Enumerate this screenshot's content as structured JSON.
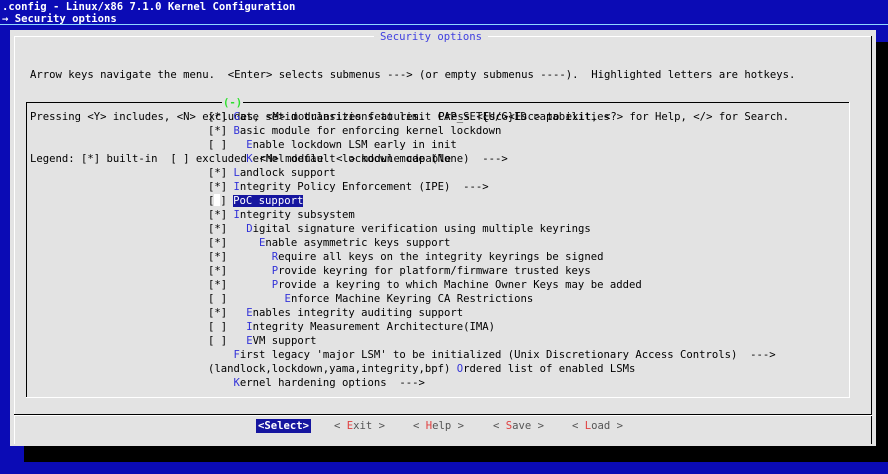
{
  "header": {
    "line1": ".config - Linux/x86 7.1.0 Kernel Configuration",
    "line2": "→ Security options"
  },
  "dialog": {
    "title": "Security options",
    "help": [
      "Arrow keys navigate the menu.  <Enter> selects submenus ---> (or empty submenus ----).  Highlighted letters are hotkeys.",
      "Pressing <Y> includes, <N> excludes, <M> modularizes features.  Press <Esc><Esc> to exit, <?> for Help, </> for Search.",
      "Legend: [*] built-in  [ ] excluded  <M> module  < > module capable"
    ],
    "scroll_indicator": "(-)"
  },
  "menu": {
    "items": [
      {
        "prefix": "[*] ",
        "hot": "G",
        "text": "ate setid transitions to limit CAP_SET{U/G}ID capabilities"
      },
      {
        "prefix": "[*] ",
        "hot": "B",
        "text": "asic module for enforcing kernel lockdown"
      },
      {
        "prefix": "[ ]   ",
        "hot": "E",
        "text": "nable lockdown LSM early in init"
      },
      {
        "prefix": "      ",
        "hot": "K",
        "text": "ernel default lockdown mode (None)  --->"
      },
      {
        "prefix": "[*] ",
        "hot": "L",
        "text": "andlock support"
      },
      {
        "prefix": "[*] ",
        "hot": "I",
        "text": "ntegrity Policy Enforcement (IPE)  --->"
      },
      {
        "prefix": "[ ] ",
        "hot": "P",
        "text": "oC support",
        "selected": true
      },
      {
        "prefix": "[*] ",
        "hot": "I",
        "text": "ntegrity subsystem"
      },
      {
        "prefix": "[*]   ",
        "hot": "D",
        "text": "igital signature verification using multiple keyrings"
      },
      {
        "prefix": "[*]     ",
        "hot": "E",
        "text": "nable asymmetric keys support"
      },
      {
        "prefix": "[*]       ",
        "hot": "R",
        "text": "equire all keys on the integrity keyrings be signed"
      },
      {
        "prefix": "[*]       ",
        "hot": "P",
        "text": "rovide keyring for platform/firmware trusted keys"
      },
      {
        "prefix": "[*]       ",
        "hot": "P",
        "text": "rovide a keyring to which Machine Owner Keys may be added"
      },
      {
        "prefix": "[ ]         ",
        "hot": "E",
        "text": "nforce Machine Keyring CA Restrictions"
      },
      {
        "prefix": "[*]   ",
        "hot": "E",
        "text": "nables integrity auditing support"
      },
      {
        "prefix": "[ ]   ",
        "hot": "I",
        "text": "ntegrity Measurement Architecture(IMA)"
      },
      {
        "prefix": "[ ]   ",
        "hot": "E",
        "text": "VM support"
      },
      {
        "prefix": "    ",
        "hot": "F",
        "text": "irst legacy 'major LSM' to be initialized (Unix Discretionary Access Controls)  --->"
      },
      {
        "prefix": "(landlock,lockdown,yama,integrity,bpf) ",
        "hot": "O",
        "text": "rdered list of enabled LSMs"
      },
      {
        "prefix": "    ",
        "hot": "K",
        "text": "ernel hardening options  --->"
      }
    ]
  },
  "buttons": {
    "select": "<Select>",
    "exit_open": "< ",
    "exit_key": "E",
    "exit_rest": "xit >",
    "help_open": "< ",
    "help_key": "H",
    "help_rest": "elp >",
    "save_open": "< ",
    "save_key": "S",
    "save_rest": "ave >",
    "load_open": "< ",
    "load_key": "L",
    "load_rest": "oad >"
  },
  "colors": {
    "background": "#0b0bb5",
    "dialog": "#e3e3e3",
    "highlight": "#15159f",
    "hotkey": "#3232d8",
    "title": "#3f3fe0",
    "scroll_indicator": "#2ee02e",
    "button_hotkey": "#e04040"
  }
}
